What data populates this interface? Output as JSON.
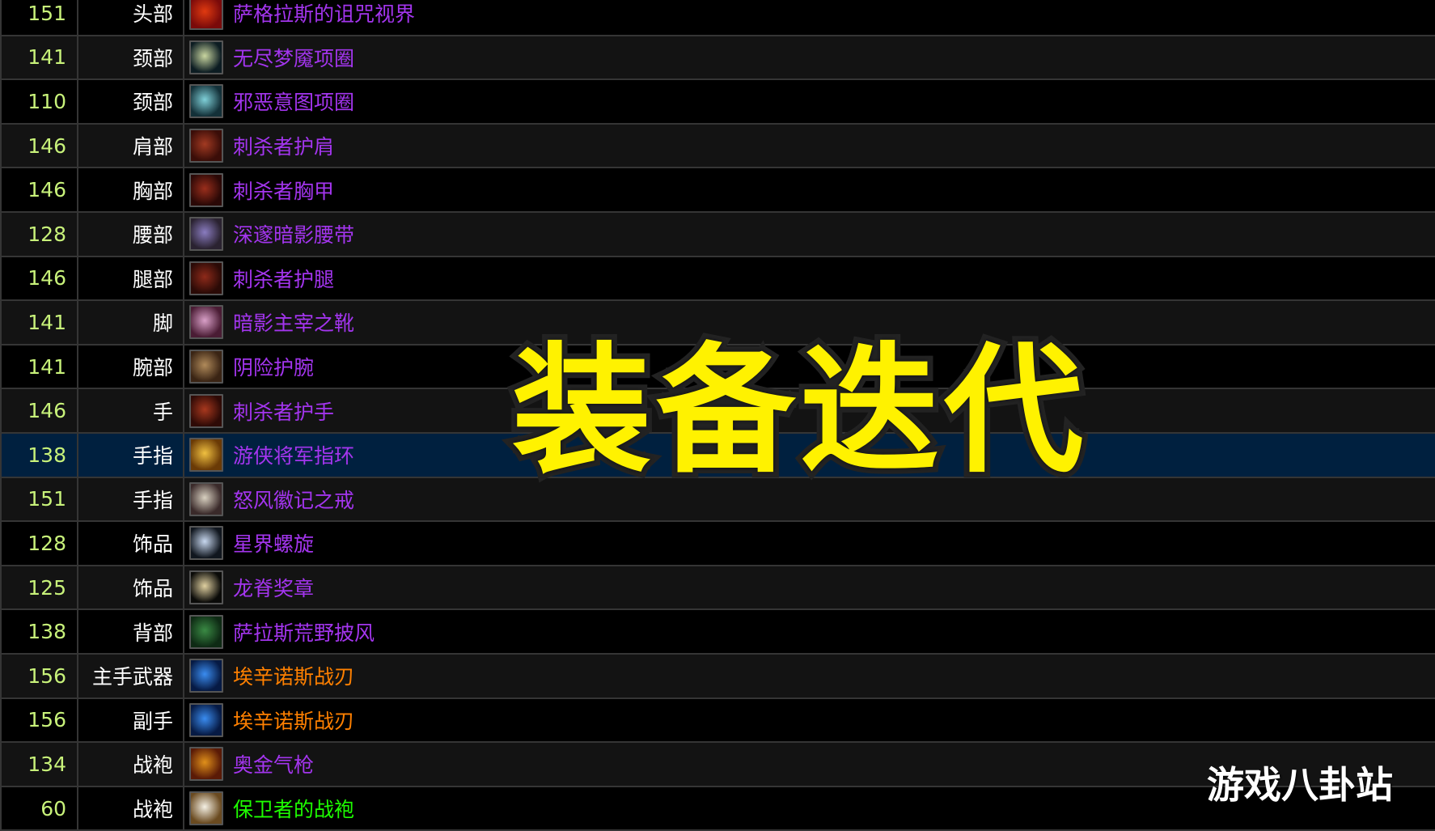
{
  "title_overlay": "装备迭代",
  "watermark": "游戏八卦站",
  "colors": {
    "epic": "#a335ee",
    "legendary": "#ff8000",
    "uncommon": "#1eff00",
    "item_level": "#c8f27a",
    "highlight_row": "#00203f",
    "title_fill": "#fff200"
  },
  "rows": [
    {
      "ilvl": "151",
      "slot": "头部",
      "item": "萨格拉斯的诅咒视界",
      "quality": "epic",
      "icon": "helm-icon",
      "icon_colors": [
        "#7a0a0a",
        "#e03a10"
      ]
    },
    {
      "ilvl": "141",
      "slot": "颈部",
      "item": "无尽梦魇项圈",
      "quality": "epic",
      "icon": "necklace-icon",
      "icon_colors": [
        "#0c1c22",
        "#c9d6a0"
      ]
    },
    {
      "ilvl": "110",
      "slot": "颈部",
      "item": "邪恶意图项圈",
      "quality": "epic",
      "icon": "necklace-icon",
      "icon_colors": [
        "#133038",
        "#7fd0d8"
      ]
    },
    {
      "ilvl": "146",
      "slot": "肩部",
      "item": "刺杀者护肩",
      "quality": "epic",
      "icon": "shoulder-icon",
      "icon_colors": [
        "#3a0d08",
        "#a23a22"
      ]
    },
    {
      "ilvl": "146",
      "slot": "胸部",
      "item": "刺杀者胸甲",
      "quality": "epic",
      "icon": "chest-icon",
      "icon_colors": [
        "#2a0806",
        "#9a2e1c"
      ]
    },
    {
      "ilvl": "128",
      "slot": "腰部",
      "item": "深邃暗影腰带",
      "quality": "epic",
      "icon": "belt-icon",
      "icon_colors": [
        "#2a2230",
        "#8a7cc0"
      ]
    },
    {
      "ilvl": "146",
      "slot": "腿部",
      "item": "刺杀者护腿",
      "quality": "epic",
      "icon": "legs-icon",
      "icon_colors": [
        "#2a0a06",
        "#8e2a1a"
      ]
    },
    {
      "ilvl": "141",
      "slot": "脚",
      "item": "暗影主宰之靴",
      "quality": "epic",
      "icon": "boots-icon",
      "icon_colors": [
        "#4a1c34",
        "#d9a0c8"
      ]
    },
    {
      "ilvl": "141",
      "slot": "腕部",
      "item": "阴险护腕",
      "quality": "epic",
      "icon": "bracer-icon",
      "icon_colors": [
        "#3a2414",
        "#b08a5a"
      ]
    },
    {
      "ilvl": "146",
      "slot": "手",
      "item": "刺杀者护手",
      "quality": "epic",
      "icon": "gloves-icon",
      "icon_colors": [
        "#2e0a06",
        "#a8381e"
      ]
    },
    {
      "ilvl": "138",
      "slot": "手指",
      "item": "游侠将军指环",
      "quality": "epic",
      "icon": "ring-icon",
      "icon_colors": [
        "#6a3a06",
        "#f0c040"
      ],
      "highlighted": true
    },
    {
      "ilvl": "151",
      "slot": "手指",
      "item": "怒风徽记之戒",
      "quality": "epic",
      "icon": "ring-icon",
      "icon_colors": [
        "#3a2a2a",
        "#d8d0c0"
      ]
    },
    {
      "ilvl": "128",
      "slot": "饰品",
      "item": "星界螺旋",
      "quality": "epic",
      "icon": "trinket-icon",
      "icon_colors": [
        "#10161e",
        "#c8d8f0"
      ]
    },
    {
      "ilvl": "125",
      "slot": "饰品",
      "item": "龙脊奖章",
      "quality": "epic",
      "icon": "trinket-icon",
      "icon_colors": [
        "#0a0a08",
        "#e0d0a0"
      ]
    },
    {
      "ilvl": "138",
      "slot": "背部",
      "item": "萨拉斯荒野披风",
      "quality": "epic",
      "icon": "cloak-icon",
      "icon_colors": [
        "#0e2a14",
        "#3a8a44"
      ]
    },
    {
      "ilvl": "156",
      "slot": "主手武器",
      "item": "埃辛诺斯战刃",
      "quality": "legendary",
      "icon": "warglaive-icon",
      "icon_colors": [
        "#061a44",
        "#3a8cf0"
      ]
    },
    {
      "ilvl": "156",
      "slot": "副手",
      "item": "埃辛诺斯战刃",
      "quality": "legendary",
      "icon": "warglaive-icon",
      "icon_colors": [
        "#061a44",
        "#3a8cf0"
      ]
    },
    {
      "ilvl": "134",
      "slot": "战袍",
      "item": "奥金气枪",
      "quality": "epic",
      "icon": "gun-icon",
      "icon_colors": [
        "#5a1a06",
        "#e0901a"
      ]
    },
    {
      "ilvl": "60",
      "slot": "战袍",
      "item": "保卫者的战袍",
      "quality": "uncommon",
      "icon": "tabard-icon",
      "icon_colors": [
        "#6a4a20",
        "#f4f0e4"
      ]
    }
  ]
}
